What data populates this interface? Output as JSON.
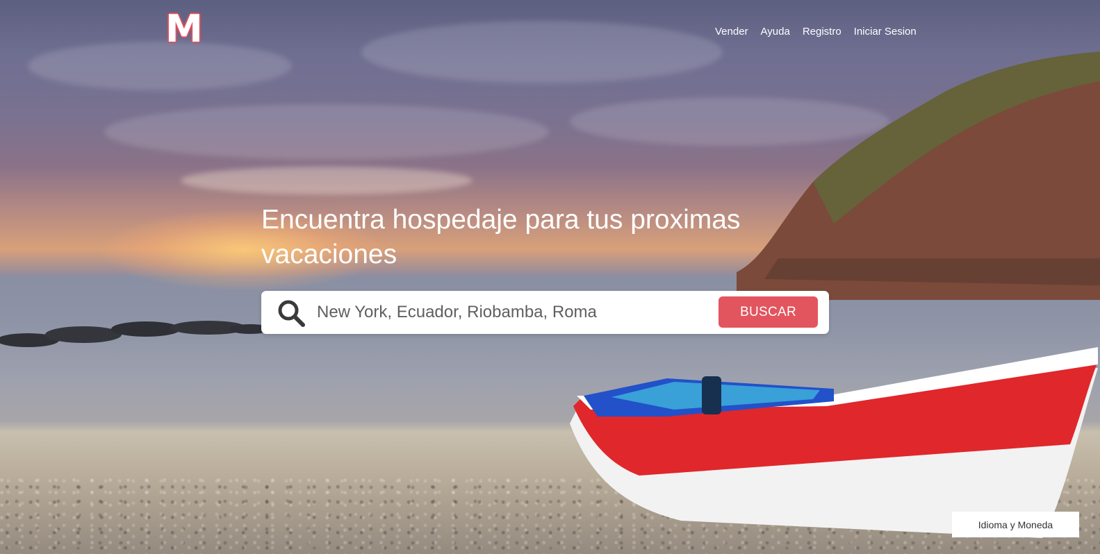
{
  "header": {
    "logo_text": "M",
    "nav": [
      {
        "label": "Vender"
      },
      {
        "label": "Ayuda"
      },
      {
        "label": "Registro"
      },
      {
        "label": "Iniciar Sesion"
      }
    ]
  },
  "hero": {
    "headline": "Encuentra hospedaje para tus proximas vacaciones",
    "search": {
      "placeholder": "New York, Ecuador, Riobamba, Roma",
      "value": "",
      "button_label": "BUSCAR",
      "icon": "search-icon"
    }
  },
  "footer": {
    "language_button_label": "Idioma y Moneda"
  },
  "colors": {
    "accent": "#e2555e",
    "text_on_image": "#ffffff"
  }
}
